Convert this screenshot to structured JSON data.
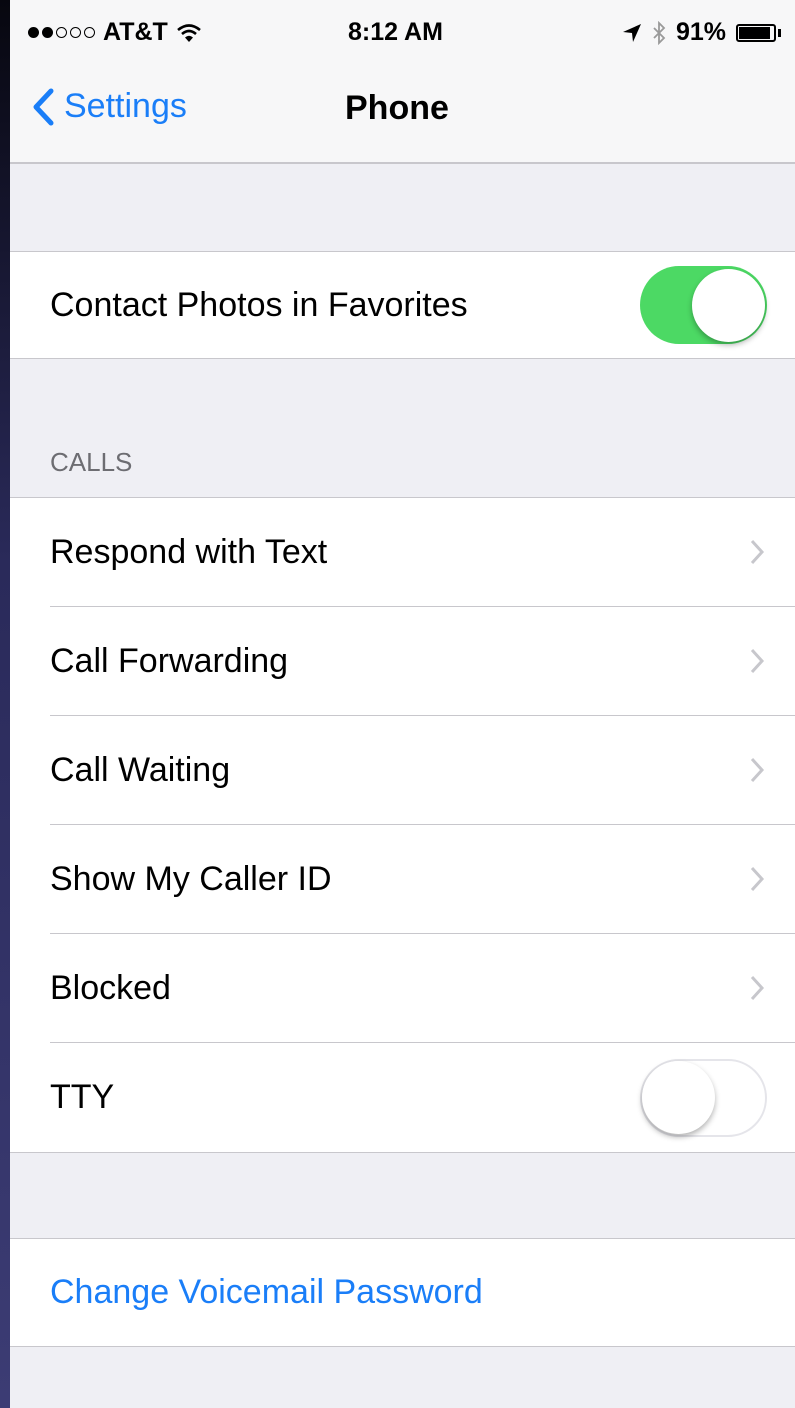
{
  "status_bar": {
    "signal_filled": 2,
    "signal_total": 5,
    "carrier": "AT&T",
    "wifi_icon": "wifi-icon",
    "time": "8:12 AM",
    "location_icon": "location-arrow-icon",
    "bluetooth_icon": "bluetooth-icon",
    "battery_percent": "91%",
    "battery_level": 0.91
  },
  "nav": {
    "back_label": "Settings",
    "title": "Phone"
  },
  "favorites": {
    "contact_photos_label": "Contact Photos in Favorites",
    "contact_photos_on": true
  },
  "calls": {
    "header": "CALLS",
    "items": [
      {
        "label": "Respond with Text"
      },
      {
        "label": "Call Forwarding"
      },
      {
        "label": "Call Waiting"
      },
      {
        "label": "Show My Caller ID"
      },
      {
        "label": "Blocked"
      }
    ],
    "tty_label": "TTY",
    "tty_on": false
  },
  "voicemail": {
    "change_password_label": "Change Voicemail Password"
  },
  "colors": {
    "accent": "#1a7ef8",
    "toggle_on": "#4cd964",
    "background": "#efeff4"
  }
}
